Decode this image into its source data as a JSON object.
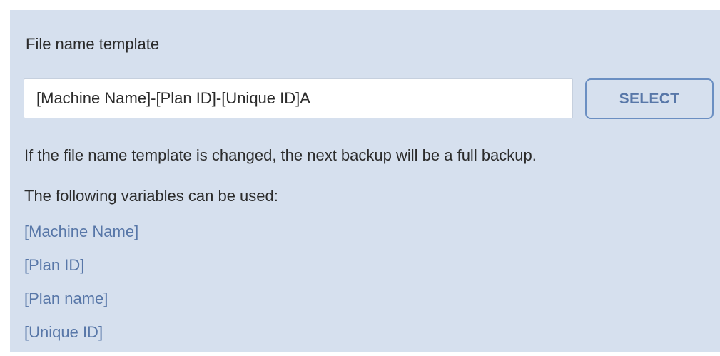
{
  "section": {
    "title": "File name template",
    "input_value": "[Machine Name]-[Plan ID]-[Unique ID]A",
    "select_label": "SELECT",
    "note": "If the file name template is changed, the next backup will be a full backup.",
    "variables_label": "The following variables can be used:",
    "variables": [
      "[Machine Name]",
      "[Plan ID]",
      "[Plan name]",
      "[Unique ID]"
    ]
  },
  "colors": {
    "panel_background": "#d6e0ee",
    "link_accent": "#5877a8",
    "button_border": "#6b8fc2",
    "text": "#2b2b2b"
  }
}
